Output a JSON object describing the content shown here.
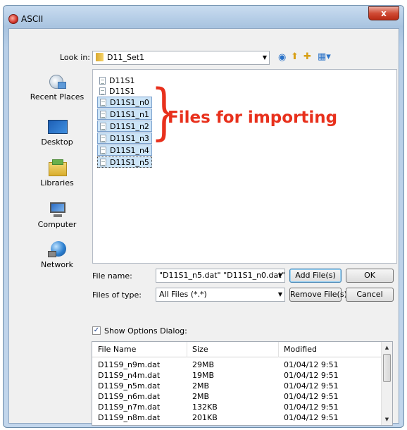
{
  "window": {
    "title": "ASCII",
    "close_label": "x"
  },
  "toolbar": {
    "look_in_label": "Look in:",
    "look_in_value": "D11_Set1",
    "icons": [
      "back-icon",
      "up-folder-icon",
      "new-folder-icon",
      "view-menu-icon"
    ]
  },
  "places": [
    {
      "label": "Recent Places",
      "icon": "recent-places-icon"
    },
    {
      "label": "Desktop",
      "icon": "desktop-icon"
    },
    {
      "label": "Libraries",
      "icon": "libraries-icon"
    },
    {
      "label": "Computer",
      "icon": "computer-icon"
    },
    {
      "label": "Network",
      "icon": "network-icon"
    }
  ],
  "files": [
    {
      "name": "D11S1",
      "selected": false
    },
    {
      "name": "D11S1",
      "selected": false
    },
    {
      "name": "D11S1_n0",
      "selected": true
    },
    {
      "name": "D11S1_n1",
      "selected": true
    },
    {
      "name": "D11S1_n2",
      "selected": true
    },
    {
      "name": "D11S1_n3",
      "selected": true
    },
    {
      "name": "D11S1_n4",
      "selected": true
    },
    {
      "name": "D11S1_n5",
      "selected": true
    }
  ],
  "annotation": {
    "text": "Files for importing",
    "brace": "}",
    "color": "#e8301c"
  },
  "form": {
    "file_name_label": "File name:",
    "file_name_value": "\"D11S1_n5.dat\" \"D11S1_n0.dat\"",
    "files_of_type_label": "Files of type:",
    "files_of_type_value": "All Files (*.*)",
    "add_files_button": "Add File(s)",
    "remove_files_button": "Remove File(s)",
    "ok_button": "OK",
    "cancel_button": "Cancel"
  },
  "options": {
    "show_options_label": "Show Options Dialog:",
    "checked": true,
    "check_mark": "✓"
  },
  "table": {
    "columns": [
      "File Name",
      "Size",
      "Modified"
    ],
    "rows": [
      [
        "D11S9_n9m.dat",
        "29MB",
        "01/04/12 9:51"
      ],
      [
        "D11S9_n4m.dat",
        "19MB",
        "01/04/12 9:51"
      ],
      [
        "D11S9_n5m.dat",
        "2MB",
        "01/04/12 9:51"
      ],
      [
        "D11S9_n6m.dat",
        "2MB",
        "01/04/12 9:51"
      ],
      [
        "D11S9_n7m.dat",
        "132KB",
        "01/04/12 9:51"
      ],
      [
        "D11S9_n8m.dat",
        "201KB",
        "01/04/12 9:51"
      ]
    ]
  }
}
